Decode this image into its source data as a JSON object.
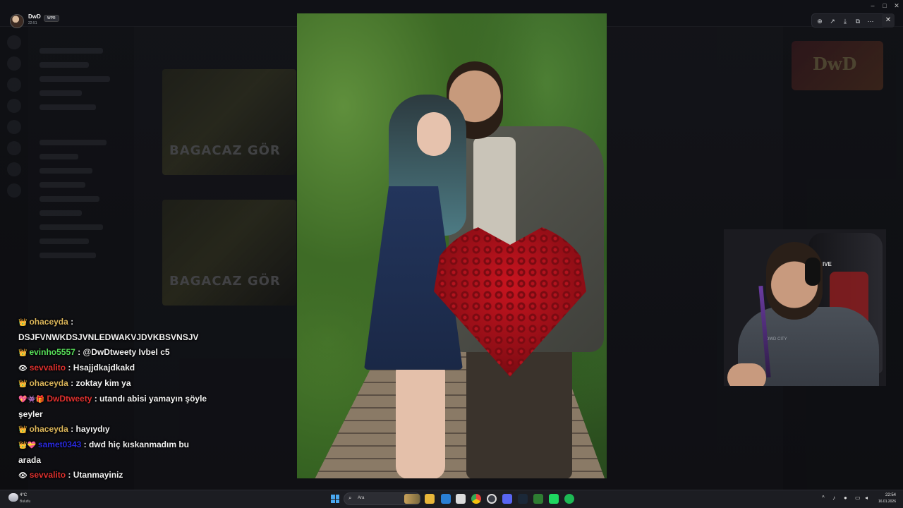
{
  "window": {
    "user_name": "DwD",
    "user_badge": "WPR",
    "user_time": "22:51",
    "center_title": ""
  },
  "embeds": [
    {
      "text": "BAGACAZ GÖR"
    },
    {
      "text": "BAGACAZ GÖR"
    }
  ],
  "member_banner": {
    "text": "DwD"
  },
  "viewer_toolbar": {
    "icons": [
      "zoom-in-icon",
      "share-icon",
      "download-icon",
      "open-external-icon",
      "more-icon"
    ],
    "close_glyph": "✕"
  },
  "webcam": {
    "chair_text": "IVE",
    "shirt_text": "DWD CITY"
  },
  "chat": {
    "messages": [
      {
        "badges": "👑",
        "user": "ohaceyda",
        "user_color": "#d9b45a",
        "text": "DSJFVNWKDSJVNLEDWAKVJDVKBSVNSJV"
      },
      {
        "badges": "👑",
        "user": "evinho5557",
        "user_color": "#58e05a",
        "text": "@DwDtweety Ivbel c5"
      },
      {
        "badges": "👁",
        "user": "sevvalito",
        "user_color": "#e0312f",
        "text": "Hsajjdkajdkakd"
      },
      {
        "badges": "👑",
        "user": "ohaceyda",
        "user_color": "#d9b45a",
        "text": "zoktay kim ya"
      },
      {
        "badges": "💖👾🎁",
        "user": "DwDtweety",
        "user_color": "#e0312f",
        "text": "utandı abisi yamayın şöyle şeyler"
      },
      {
        "badges": "👑",
        "user": "ohaceyda",
        "user_color": "#d9b45a",
        "text": "hayıydıy"
      },
      {
        "badges": "👑💝",
        "user": "samet0343",
        "user_color": "#2a2ae0",
        "text": "dwd hiç kıskanmadım bu arada"
      },
      {
        "badges": "👁",
        "user": "sevvalito",
        "user_color": "#e0312f",
        "text": "Utanmayiniz"
      }
    ]
  },
  "taskbar": {
    "weather_temp": "4°C",
    "weather_cond": "Bulutlu",
    "search_placeholder": "Ara",
    "clock_time": "22:54",
    "clock_date": "16.01.2026",
    "apps": [
      "file-explorer-icon",
      "edge-icon",
      "store-icon",
      "chrome-icon",
      "obs-icon",
      "discord-icon",
      "steam-icon",
      "game-icon",
      "spotify-icon",
      "terminal-icon"
    ]
  }
}
